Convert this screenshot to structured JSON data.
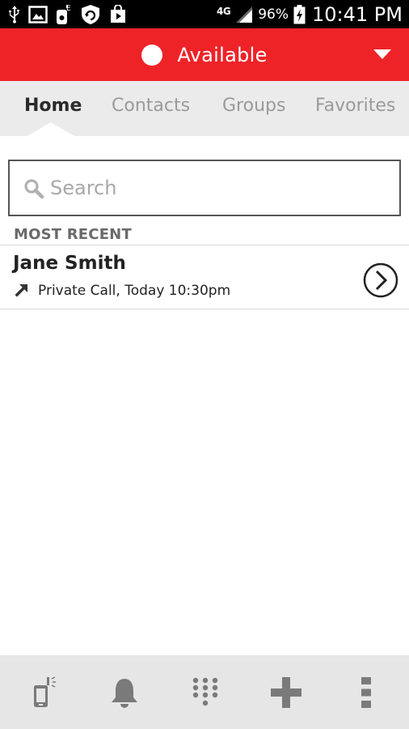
{
  "status_bar": {
    "network": "4G",
    "battery": "96%",
    "time": "10:41 PM"
  },
  "presence": {
    "label": "Available",
    "dot_color": "#ffffff",
    "bar_color": "#ee2328"
  },
  "tabs": [
    {
      "label": "Home",
      "active": true
    },
    {
      "label": "Contacts",
      "active": false
    },
    {
      "label": "Groups",
      "active": false
    },
    {
      "label": "Favorites",
      "active": false
    }
  ],
  "search": {
    "placeholder": "Search",
    "value": ""
  },
  "section": {
    "title": "MOST RECENT"
  },
  "recent": [
    {
      "name": "Jane Smith",
      "detail": "Private Call, Today 10:30pm",
      "direction_icon": "outgoing-call-arrow-icon",
      "action_icon": "chevron-right-circle-icon"
    }
  ],
  "bottom_nav": [
    {
      "icon": "ptt-phone-icon"
    },
    {
      "icon": "bell-icon"
    },
    {
      "icon": "dialpad-icon"
    },
    {
      "icon": "plus-icon"
    },
    {
      "icon": "overflow-menu-icon"
    }
  ]
}
